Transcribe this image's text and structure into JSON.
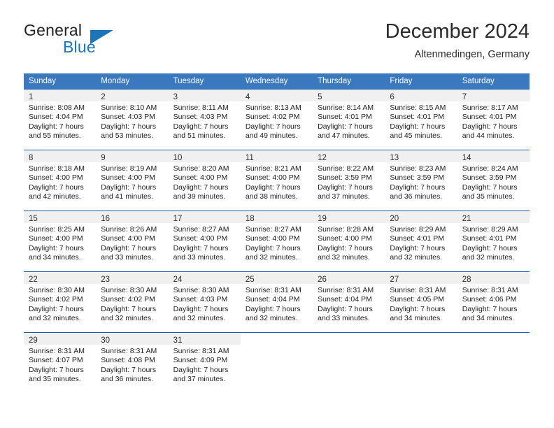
{
  "brand": {
    "word_one": "General",
    "word_two": "Blue",
    "accent_color": "#1b75bb"
  },
  "header": {
    "title": "December 2024",
    "subtitle": "Altenmedingen, Germany"
  },
  "theme": {
    "header_bg": "#3a78bf",
    "row_border": "#1b5fa8",
    "daynum_bg": "#f0f0f0"
  },
  "weekday_headers": [
    "Sunday",
    "Monday",
    "Tuesday",
    "Wednesday",
    "Thursday",
    "Friday",
    "Saturday"
  ],
  "weeks": [
    {
      "days": [
        {
          "num": "1",
          "sunrise": "Sunrise: 8:08 AM",
          "sunset": "Sunset: 4:04 PM",
          "daylight_line1": "Daylight: 7 hours",
          "daylight_line2": "and 55 minutes."
        },
        {
          "num": "2",
          "sunrise": "Sunrise: 8:10 AM",
          "sunset": "Sunset: 4:03 PM",
          "daylight_line1": "Daylight: 7 hours",
          "daylight_line2": "and 53 minutes."
        },
        {
          "num": "3",
          "sunrise": "Sunrise: 8:11 AM",
          "sunset": "Sunset: 4:03 PM",
          "daylight_line1": "Daylight: 7 hours",
          "daylight_line2": "and 51 minutes."
        },
        {
          "num": "4",
          "sunrise": "Sunrise: 8:13 AM",
          "sunset": "Sunset: 4:02 PM",
          "daylight_line1": "Daylight: 7 hours",
          "daylight_line2": "and 49 minutes."
        },
        {
          "num": "5",
          "sunrise": "Sunrise: 8:14 AM",
          "sunset": "Sunset: 4:01 PM",
          "daylight_line1": "Daylight: 7 hours",
          "daylight_line2": "and 47 minutes."
        },
        {
          "num": "6",
          "sunrise": "Sunrise: 8:15 AM",
          "sunset": "Sunset: 4:01 PM",
          "daylight_line1": "Daylight: 7 hours",
          "daylight_line2": "and 45 minutes."
        },
        {
          "num": "7",
          "sunrise": "Sunrise: 8:17 AM",
          "sunset": "Sunset: 4:01 PM",
          "daylight_line1": "Daylight: 7 hours",
          "daylight_line2": "and 44 minutes."
        }
      ]
    },
    {
      "days": [
        {
          "num": "8",
          "sunrise": "Sunrise: 8:18 AM",
          "sunset": "Sunset: 4:00 PM",
          "daylight_line1": "Daylight: 7 hours",
          "daylight_line2": "and 42 minutes."
        },
        {
          "num": "9",
          "sunrise": "Sunrise: 8:19 AM",
          "sunset": "Sunset: 4:00 PM",
          "daylight_line1": "Daylight: 7 hours",
          "daylight_line2": "and 41 minutes."
        },
        {
          "num": "10",
          "sunrise": "Sunrise: 8:20 AM",
          "sunset": "Sunset: 4:00 PM",
          "daylight_line1": "Daylight: 7 hours",
          "daylight_line2": "and 39 minutes."
        },
        {
          "num": "11",
          "sunrise": "Sunrise: 8:21 AM",
          "sunset": "Sunset: 4:00 PM",
          "daylight_line1": "Daylight: 7 hours",
          "daylight_line2": "and 38 minutes."
        },
        {
          "num": "12",
          "sunrise": "Sunrise: 8:22 AM",
          "sunset": "Sunset: 3:59 PM",
          "daylight_line1": "Daylight: 7 hours",
          "daylight_line2": "and 37 minutes."
        },
        {
          "num": "13",
          "sunrise": "Sunrise: 8:23 AM",
          "sunset": "Sunset: 3:59 PM",
          "daylight_line1": "Daylight: 7 hours",
          "daylight_line2": "and 36 minutes."
        },
        {
          "num": "14",
          "sunrise": "Sunrise: 8:24 AM",
          "sunset": "Sunset: 3:59 PM",
          "daylight_line1": "Daylight: 7 hours",
          "daylight_line2": "and 35 minutes."
        }
      ]
    },
    {
      "days": [
        {
          "num": "15",
          "sunrise": "Sunrise: 8:25 AM",
          "sunset": "Sunset: 4:00 PM",
          "daylight_line1": "Daylight: 7 hours",
          "daylight_line2": "and 34 minutes."
        },
        {
          "num": "16",
          "sunrise": "Sunrise: 8:26 AM",
          "sunset": "Sunset: 4:00 PM",
          "daylight_line1": "Daylight: 7 hours",
          "daylight_line2": "and 33 minutes."
        },
        {
          "num": "17",
          "sunrise": "Sunrise: 8:27 AM",
          "sunset": "Sunset: 4:00 PM",
          "daylight_line1": "Daylight: 7 hours",
          "daylight_line2": "and 33 minutes."
        },
        {
          "num": "18",
          "sunrise": "Sunrise: 8:27 AM",
          "sunset": "Sunset: 4:00 PM",
          "daylight_line1": "Daylight: 7 hours",
          "daylight_line2": "and 32 minutes."
        },
        {
          "num": "19",
          "sunrise": "Sunrise: 8:28 AM",
          "sunset": "Sunset: 4:00 PM",
          "daylight_line1": "Daylight: 7 hours",
          "daylight_line2": "and 32 minutes."
        },
        {
          "num": "20",
          "sunrise": "Sunrise: 8:29 AM",
          "sunset": "Sunset: 4:01 PM",
          "daylight_line1": "Daylight: 7 hours",
          "daylight_line2": "and 32 minutes."
        },
        {
          "num": "21",
          "sunrise": "Sunrise: 8:29 AM",
          "sunset": "Sunset: 4:01 PM",
          "daylight_line1": "Daylight: 7 hours",
          "daylight_line2": "and 32 minutes."
        }
      ]
    },
    {
      "days": [
        {
          "num": "22",
          "sunrise": "Sunrise: 8:30 AM",
          "sunset": "Sunset: 4:02 PM",
          "daylight_line1": "Daylight: 7 hours",
          "daylight_line2": "and 32 minutes."
        },
        {
          "num": "23",
          "sunrise": "Sunrise: 8:30 AM",
          "sunset": "Sunset: 4:02 PM",
          "daylight_line1": "Daylight: 7 hours",
          "daylight_line2": "and 32 minutes."
        },
        {
          "num": "24",
          "sunrise": "Sunrise: 8:30 AM",
          "sunset": "Sunset: 4:03 PM",
          "daylight_line1": "Daylight: 7 hours",
          "daylight_line2": "and 32 minutes."
        },
        {
          "num": "25",
          "sunrise": "Sunrise: 8:31 AM",
          "sunset": "Sunset: 4:04 PM",
          "daylight_line1": "Daylight: 7 hours",
          "daylight_line2": "and 32 minutes."
        },
        {
          "num": "26",
          "sunrise": "Sunrise: 8:31 AM",
          "sunset": "Sunset: 4:04 PM",
          "daylight_line1": "Daylight: 7 hours",
          "daylight_line2": "and 33 minutes."
        },
        {
          "num": "27",
          "sunrise": "Sunrise: 8:31 AM",
          "sunset": "Sunset: 4:05 PM",
          "daylight_line1": "Daylight: 7 hours",
          "daylight_line2": "and 34 minutes."
        },
        {
          "num": "28",
          "sunrise": "Sunrise: 8:31 AM",
          "sunset": "Sunset: 4:06 PM",
          "daylight_line1": "Daylight: 7 hours",
          "daylight_line2": "and 34 minutes."
        }
      ]
    },
    {
      "days": [
        {
          "num": "29",
          "sunrise": "Sunrise: 8:31 AM",
          "sunset": "Sunset: 4:07 PM",
          "daylight_line1": "Daylight: 7 hours",
          "daylight_line2": "and 35 minutes."
        },
        {
          "num": "30",
          "sunrise": "Sunrise: 8:31 AM",
          "sunset": "Sunset: 4:08 PM",
          "daylight_line1": "Daylight: 7 hours",
          "daylight_line2": "and 36 minutes."
        },
        {
          "num": "31",
          "sunrise": "Sunrise: 8:31 AM",
          "sunset": "Sunset: 4:09 PM",
          "daylight_line1": "Daylight: 7 hours",
          "daylight_line2": "and 37 minutes."
        },
        {
          "num": "",
          "sunrise": "",
          "sunset": "",
          "daylight_line1": "",
          "daylight_line2": ""
        },
        {
          "num": "",
          "sunrise": "",
          "sunset": "",
          "daylight_line1": "",
          "daylight_line2": ""
        },
        {
          "num": "",
          "sunrise": "",
          "sunset": "",
          "daylight_line1": "",
          "daylight_line2": ""
        },
        {
          "num": "",
          "sunrise": "",
          "sunset": "",
          "daylight_line1": "",
          "daylight_line2": ""
        }
      ]
    }
  ]
}
